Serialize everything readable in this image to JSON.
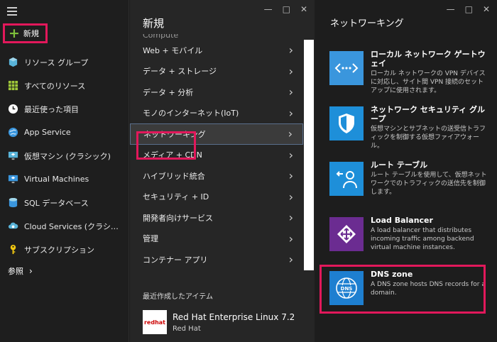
{
  "sidebar": {
    "new_label": "新規",
    "items": [
      {
        "label": "リソース グループ",
        "icon": "resource-group-icon"
      },
      {
        "label": "すべてのリソース",
        "icon": "all-resources-icon"
      },
      {
        "label": "最近使った項目",
        "icon": "clock-icon"
      },
      {
        "label": "App Service",
        "icon": "globe-icon"
      },
      {
        "label": "仮想マシン (クラシック)",
        "icon": "vm-classic-icon"
      },
      {
        "label": "Virtual Machines",
        "icon": "vm-icon"
      },
      {
        "label": "SQL データベース",
        "icon": "sql-icon"
      },
      {
        "label": "Cloud Services (クラシ…",
        "icon": "cloud-icon"
      },
      {
        "label": "サブスクリプション",
        "icon": "key-icon"
      }
    ],
    "browse_label": "参照"
  },
  "new_blade": {
    "title": "新規",
    "cut_item": "Compute",
    "items": [
      "Web + モバイル",
      "データ + ストレージ",
      "データ + 分析",
      "モノのインターネット(IoT)",
      "ネットワーキング",
      "メディア + CDN",
      "ハイブリッド統合",
      "セキュリティ + ID",
      "開発者向けサービス",
      "管理",
      "コンテナー アプリ"
    ],
    "recent_heading": "最近作成したアイテム",
    "recent": {
      "title": "Red Hat Enterprise Linux 7.2",
      "subtitle": "Red Hat",
      "logo_text": "redhat"
    }
  },
  "net_blade": {
    "title": "ネットワーキング",
    "cards": [
      {
        "title": "ローカル ネットワーク ゲートウェイ",
        "desc": "ローカル ネットワークの VPN デバイスに対応し、サイト間 VPN 接続のセットアップに使用されます。",
        "icon": "gateway-icon",
        "color": "#3a96dd"
      },
      {
        "title": "ネットワーク セキュリティ グループ",
        "desc": "仮想マシンとサブネットの送受信トラフィックを制御する仮想ファイアウォール。",
        "icon": "shield-icon",
        "color": "#1e8fd9"
      },
      {
        "title": "ルート テーブル",
        "desc": "ルート テーブルを使用して、仮想ネットワークでのトラフィックの送信先を制御します。",
        "icon": "route-icon",
        "color": "#1e8fd9"
      },
      {
        "title": "Load Balancer",
        "desc": "A load balancer that distributes incoming traffic among backend virtual machine instances.",
        "icon": "load-balancer-icon",
        "color": "#6b2c91"
      },
      {
        "title": "DNS zone",
        "desc": "A DNS zone hosts DNS records for a domain.",
        "icon": "dns-icon",
        "color": "#1e7fd0"
      }
    ]
  },
  "colors": {
    "highlight": "#e2185b",
    "accent_green": "#7ec03b"
  }
}
